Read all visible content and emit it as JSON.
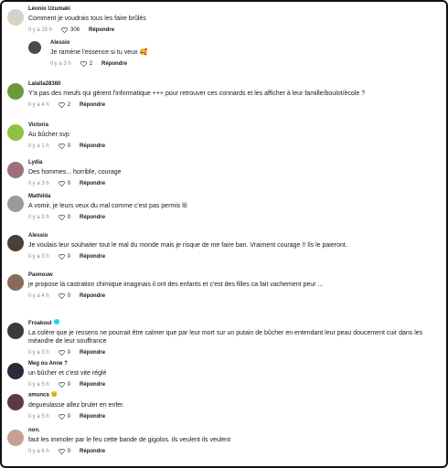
{
  "comments": [
    {
      "username": "Léonio Uzumaki",
      "text": "Comment je voudrais tous les faire brûlés",
      "time": "Il y a 15 h",
      "likes": "306",
      "reply": "Répondre",
      "avatar_color": "#d9d0c8"
    },
    {
      "username": "Alessio",
      "text": "Je ramène l'essence si tu veux 🥰",
      "time": "Il y a 3 h",
      "likes": "2",
      "reply": "Répondre",
      "avatar_color": "#4a4a4a"
    },
    {
      "username": "Lalalla28360",
      "text": "Y'a pas des meufs qui gèrent l'informatique +++ pour retrouver ces connards et les afficher à leur famille/boulot/école ?",
      "time": "Il y a 4 h",
      "likes": "2",
      "reply": "Répondre",
      "avatar_color": "#6b9a3a"
    },
    {
      "username": "Victoria",
      "text": "Au bûcher svp",
      "time": "Il y a 1 h",
      "likes": "0",
      "reply": "Répondre",
      "avatar_color": "#8fc23f"
    },
    {
      "username": "Lydia",
      "text": "Des hommes... horrible, courage",
      "time": "Il y a 3 h",
      "likes": "0",
      "reply": "Répondre",
      "avatar_color": "#a0707a"
    },
    {
      "username": "Mathilda",
      "text": "A vomir, je leurs veux du mal comme c'est pas permis lô",
      "time": "Il y a 3 h",
      "likes": "0",
      "reply": "Répondre",
      "avatar_color": "#9a9a9a"
    },
    {
      "username": "Alessio",
      "text": "Je voulais leur souhaiter tout le mal du monde mais je risque de me faire ban. Vraiment courage !! Ils le paieront.",
      "time": "Il y a 3 h",
      "likes": "0",
      "reply": "Répondre",
      "avatar_color": "#4a4038"
    },
    {
      "username": "Paonouw",
      "text": "je propose la castration chimique imaginais il ont des enfants et c'est des filles ca fait vachement peur ...",
      "time": "Il y a 4 h",
      "likes": "0",
      "reply": "Répondre",
      "avatar_color": "#8a6a5a"
    },
    {
      "username": "Froakout",
      "text": "La colère que je ressens ne pourrait être calmer que par leur mort sur un putain de bûcher en entendant leur peau doucement cuir dans les méandre de leur souffrance",
      "time": "Il y a 3 h",
      "likes": "0",
      "reply": "Répondre",
      "avatar_color": "#3a3a3a"
    },
    {
      "username": "Meg ou Anne ?",
      "text": "un bûcher et c'est vite réglé",
      "time": "Il y a 5 h",
      "likes": "0",
      "reply": "Répondre",
      "avatar_color": "#2a2a3a"
    },
    {
      "username": "amunca",
      "text": "degueulasse allez bruler en enfer.",
      "time": "Il y a 5 h",
      "likes": "0",
      "reply": "Répondre",
      "avatar_color": "#5a3a4a"
    },
    {
      "username": "non.",
      "text": "faut les immoler par le feu cette bande de gigolos. ils veulent ils veulent",
      "time": "Il y a 6 h",
      "likes": "0",
      "reply": "Répondre",
      "avatar_color": "#c8a090"
    }
  ]
}
